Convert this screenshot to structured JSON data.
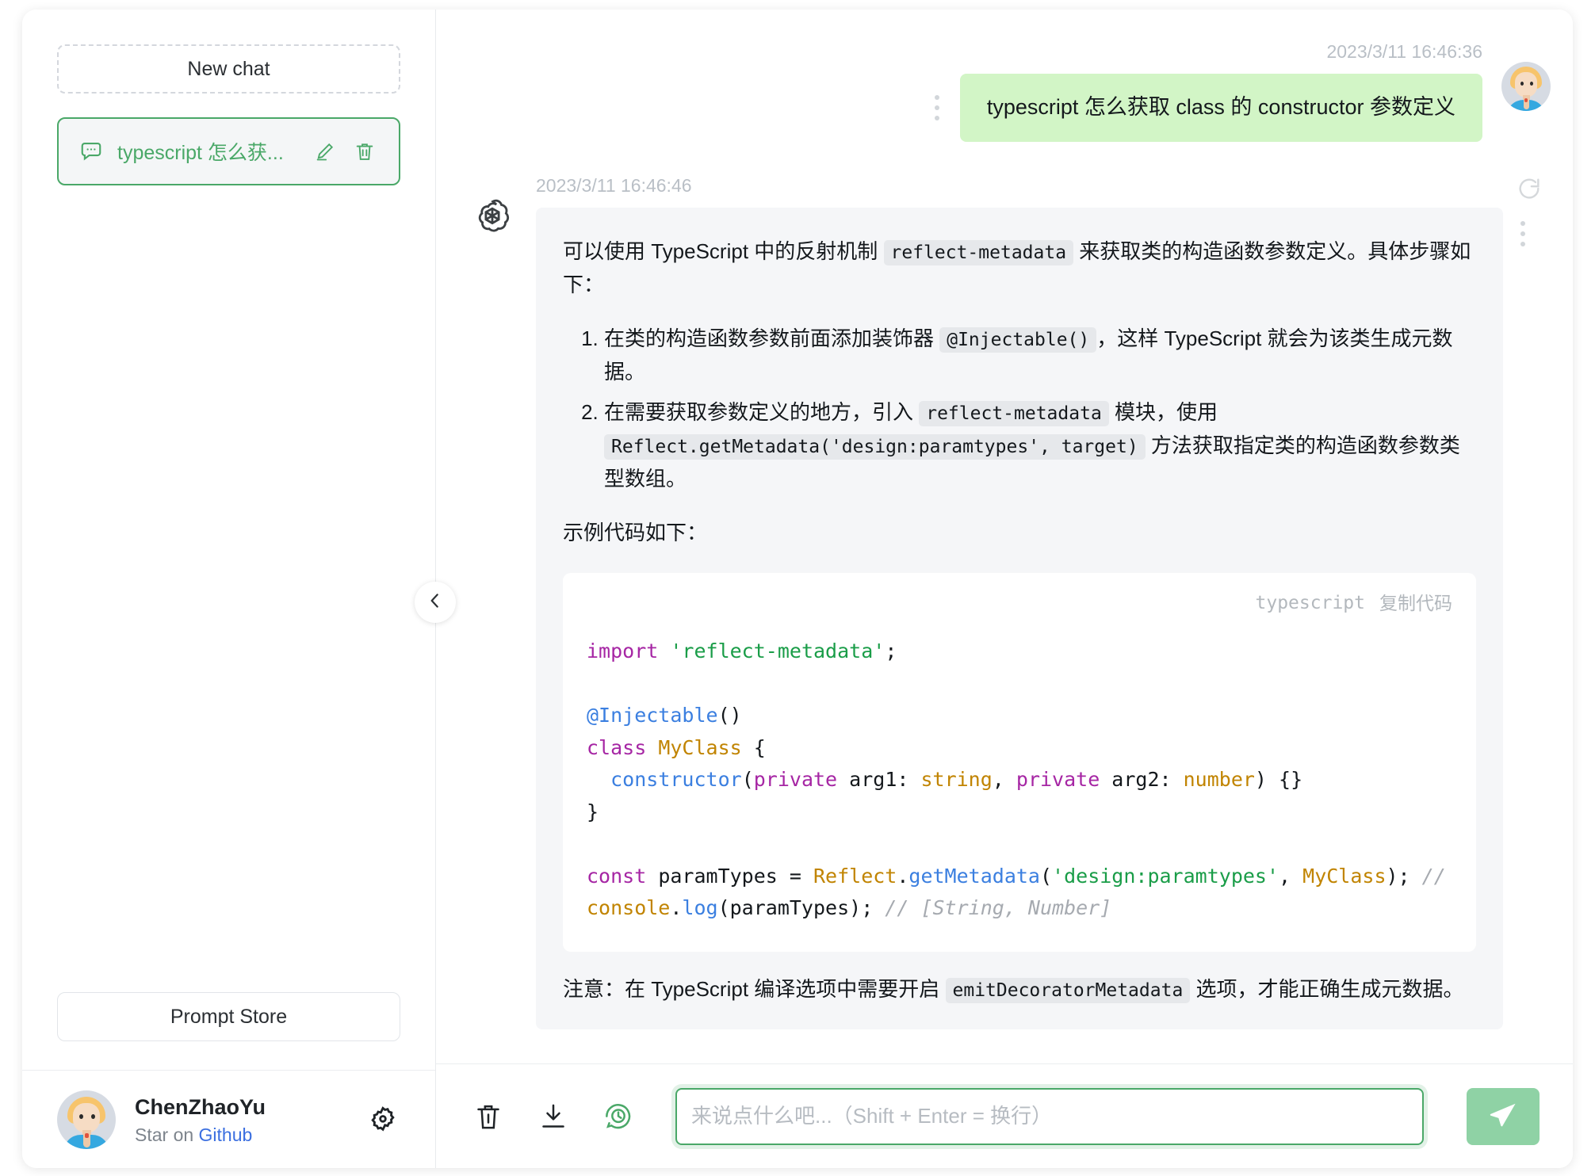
{
  "sidebar": {
    "new_chat_label": "New chat",
    "chats": [
      {
        "title": "typescript 怎么获...",
        "icon": "chat-bubble-icon",
        "edit_icon": "pencil-icon",
        "delete_icon": "trash-icon",
        "active": true
      }
    ],
    "prompt_store_label": "Prompt Store",
    "user": {
      "name": "ChenZhaoYu",
      "sub_prefix": "Star on ",
      "sub_link": "Github",
      "settings_icon": "gear-icon"
    },
    "collapse_icon": "chevron-left-icon"
  },
  "conversation": {
    "user_message": {
      "timestamp": "2023/3/11 16:46:36",
      "text": "typescript 怎么获取 class 的 constructor 参数定义",
      "menu_icon": "vertical-dots-icon"
    },
    "bot_message": {
      "timestamp": "2023/3/11 16:46:46",
      "logo_icon": "openai-logo-icon",
      "intro_a": "可以使用 TypeScript 中的反射机制 ",
      "intro_code": "reflect-metadata",
      "intro_b": " 来获取类的构造函数参数定义。具体步骤如下：",
      "steps": [
        {
          "a": "在类的构造函数参数前面添加装饰器 ",
          "code": "@Injectable()",
          "b": "，这样 TypeScript 就会为该类生成元数据。"
        },
        {
          "a": "在需要获取参数定义的地方，引入 ",
          "code": "reflect-metadata",
          "b": " 模块，使用 ",
          "code2": "Reflect.getMetadata('design:paramtypes', target)",
          "c": " 方法获取指定类的构造函数参数类型数组。"
        }
      ],
      "example_label": "示例代码如下：",
      "code_block": {
        "language": "typescript",
        "copy_label": "复制代码",
        "lines": [
          "import 'reflect-metadata';",
          "",
          "@Injectable()",
          "class MyClass {",
          "  constructor(private arg1: string, private arg2: number) {}",
          "}",
          "",
          "const paramTypes = Reflect.getMetadata('design:paramtypes', MyClass); // 获取 My",
          "console.log(paramTypes); // [String, Number]"
        ]
      },
      "note_a": "注意：在 TypeScript 编译选项中需要开启 ",
      "note_code": "emitDecoratorMetadata",
      "note_b": " 选项，才能正确生成元数据。",
      "refresh_icon": "refresh-icon",
      "menu_icon": "vertical-dots-icon"
    }
  },
  "composer": {
    "clear_icon": "trash-icon",
    "export_icon": "download-icon",
    "history_icon": "chat-history-icon",
    "placeholder": "来说点什么吧...（Shift + Enter = 换行）",
    "value": "",
    "send_icon": "send-icon"
  },
  "colors": {
    "accent_green": "#4aa868",
    "user_bubble": "#d2f5c6",
    "bot_bubble": "#f5f6f8",
    "link_blue": "#3b6fe0",
    "send_button": "#8fd2a5"
  }
}
